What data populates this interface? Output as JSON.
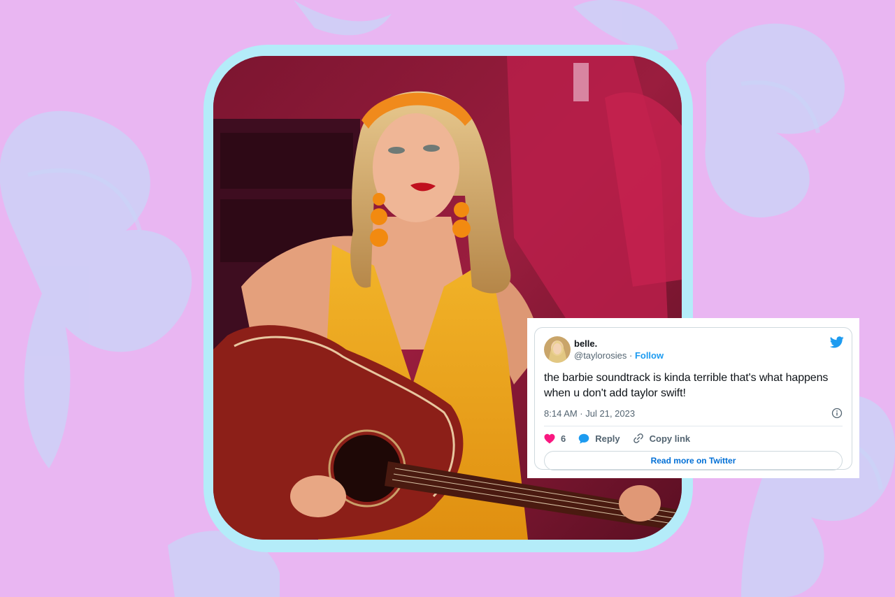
{
  "tweet": {
    "display_name": "belle.",
    "handle": "@taylorosies",
    "separator": "·",
    "follow_label": "Follow",
    "text": "the barbie soundtrack is kinda terrible that's what happens when u don't add taylor swift!",
    "timestamp": "8:14 AM · Jul 21, 2023",
    "likes_count": "6",
    "reply_label": "Reply",
    "copy_link_label": "Copy link",
    "read_more_label": "Read more on Twitter"
  },
  "icons": {
    "brand": "twitter-bird-icon",
    "info": "info-icon",
    "like": "heart-icon",
    "reply": "reply-bubble-icon",
    "copy": "link-icon"
  },
  "colors": {
    "background": "#e9b6f2",
    "frame": "#b4ecf9",
    "twitter_blue": "#1d9bf0",
    "heart": "#f91880",
    "link_blue": "#006fd6"
  }
}
